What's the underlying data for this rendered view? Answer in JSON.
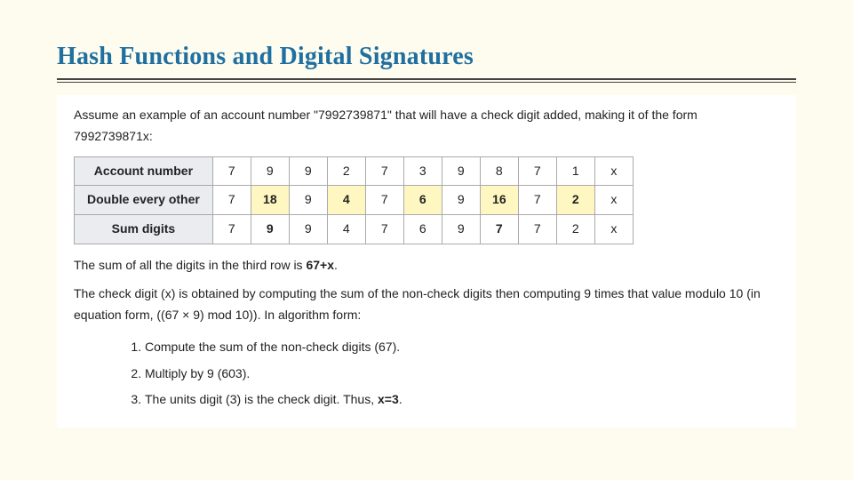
{
  "title": "Hash Functions and Digital Signatures",
  "intro": "Assume an example of an account number \"7992739871\" that will have a check digit added, making it of the form 7992739871x:",
  "table": {
    "row_labels": [
      "Account number",
      "Double every other",
      "Sum digits"
    ],
    "account": [
      "7",
      "9",
      "9",
      "2",
      "7",
      "3",
      "9",
      "8",
      "7",
      "1",
      "x"
    ],
    "doubled": [
      "7",
      "18",
      "9",
      "4",
      "7",
      "6",
      "9",
      "16",
      "7",
      "2",
      "x"
    ],
    "doubled_hl": [
      false,
      true,
      false,
      true,
      false,
      true,
      false,
      true,
      false,
      true,
      false
    ],
    "sumd": [
      "7",
      "9",
      "9",
      "4",
      "7",
      "6",
      "9",
      "7",
      "7",
      "2",
      "x"
    ],
    "sumd_bold": [
      false,
      true,
      false,
      false,
      false,
      false,
      false,
      true,
      false,
      false,
      false
    ]
  },
  "p_sum_a": "The sum of all the digits in the third row is ",
  "p_sum_b": "67+x",
  "p_sum_c": ".",
  "p_check": "The check digit (x) is obtained by computing the sum of the non-check digits then computing 9 times that value modulo 10 (in equation  form, ((67 × 9) mod 10)). In algorithm form:",
  "steps": {
    "s1": "Compute the sum of the non-check digits (67).",
    "s2": "Multiply by 9 (603).",
    "s3a": "The units digit (3) is the check digit. Thus, ",
    "s3b": "x=3",
    "s3c": "."
  }
}
